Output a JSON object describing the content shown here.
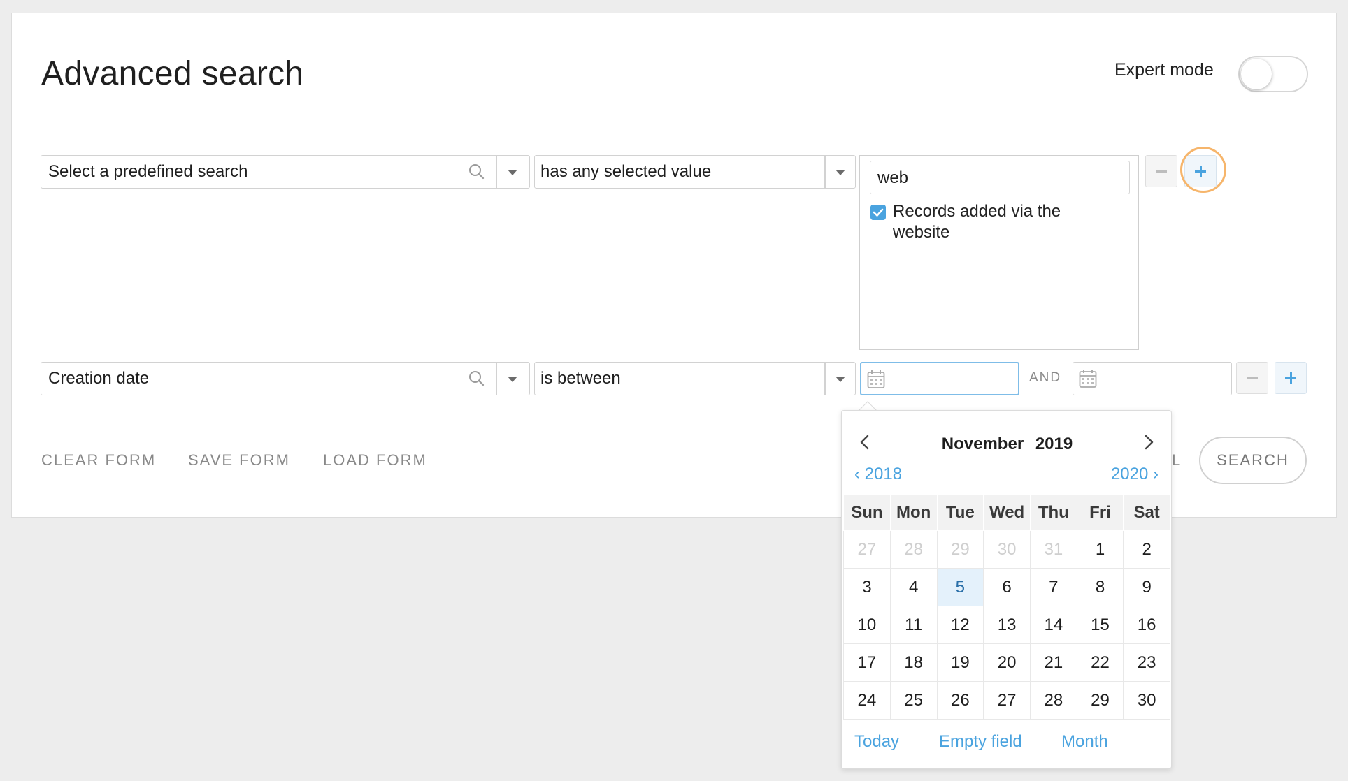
{
  "header": {
    "title": "Advanced search",
    "expert_mode_label": "Expert mode",
    "expert_mode_on": false
  },
  "row1": {
    "field": "Select a predefined search",
    "operator": "has any selected value",
    "value_input": "web",
    "checkbox_label": "Records added via the website",
    "checkbox_checked": true
  },
  "row2": {
    "field": "Creation date",
    "operator": "is between",
    "date_from": "",
    "and_label": "AND",
    "date_to": ""
  },
  "actions": {
    "clear": "CLEAR FORM",
    "save": "SAVE FORM",
    "load": "LOAD FORM",
    "cancel_partial": "L",
    "search": "SEARCH"
  },
  "calendar": {
    "month": "November",
    "year": "2019",
    "prev_year": "2018",
    "next_year": "2020",
    "weekdays": [
      "Sun",
      "Mon",
      "Tue",
      "Wed",
      "Thu",
      "Fri",
      "Sat"
    ],
    "weeks": [
      [
        {
          "d": "27",
          "m": true
        },
        {
          "d": "28",
          "m": true
        },
        {
          "d": "29",
          "m": true
        },
        {
          "d": "30",
          "m": true
        },
        {
          "d": "31",
          "m": true
        },
        {
          "d": "1"
        },
        {
          "d": "2"
        }
      ],
      [
        {
          "d": "3"
        },
        {
          "d": "4"
        },
        {
          "d": "5",
          "s": true
        },
        {
          "d": "6"
        },
        {
          "d": "7"
        },
        {
          "d": "8"
        },
        {
          "d": "9"
        }
      ],
      [
        {
          "d": "10"
        },
        {
          "d": "11"
        },
        {
          "d": "12"
        },
        {
          "d": "13"
        },
        {
          "d": "14"
        },
        {
          "d": "15"
        },
        {
          "d": "16"
        }
      ],
      [
        {
          "d": "17"
        },
        {
          "d": "18"
        },
        {
          "d": "19"
        },
        {
          "d": "20"
        },
        {
          "d": "21"
        },
        {
          "d": "22"
        },
        {
          "d": "23"
        }
      ],
      [
        {
          "d": "24"
        },
        {
          "d": "25"
        },
        {
          "d": "26"
        },
        {
          "d": "27"
        },
        {
          "d": "28"
        },
        {
          "d": "29"
        },
        {
          "d": "30"
        }
      ]
    ],
    "footer": {
      "today": "Today",
      "empty": "Empty field",
      "month": "Month"
    }
  },
  "colors": {
    "accent": "#4aa3df",
    "highlight_ring": "#f6b56b"
  },
  "icons": [
    "search-icon",
    "chevron-down-icon",
    "calendar-icon",
    "minus-icon",
    "plus-icon",
    "chevron-left-icon",
    "chevron-right-icon"
  ]
}
